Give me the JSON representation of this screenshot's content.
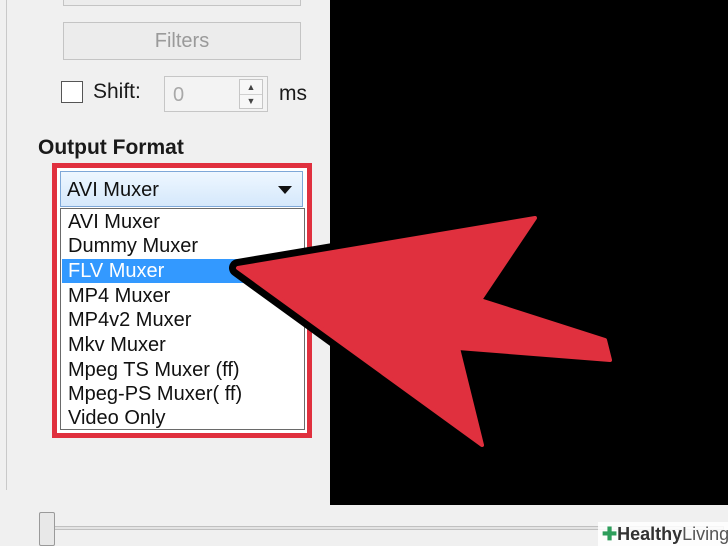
{
  "filters_label": "Filters",
  "shift": {
    "label": "Shift:",
    "checked": false,
    "value": "0",
    "unit": "ms"
  },
  "output_format": {
    "title": "Output Format",
    "selected": "AVI Muxer",
    "options": [
      "AVI Muxer",
      "Dummy Muxer",
      "FLV Muxer",
      "MP4 Muxer",
      "MP4v2 Muxer",
      "Mkv Muxer",
      "Mpeg TS Muxer (ff)",
      "Mpeg-PS Muxer( ff)",
      "Video Only"
    ],
    "highlighted": "FLV Muxer"
  },
  "watermark": {
    "bold": "Healthy",
    "light": "Living"
  },
  "colors": {
    "highlight": "#e0303e",
    "selection": "#3399ff",
    "video_bg": "#000000"
  },
  "icons": {
    "combo_arrow": "chevron-down-icon",
    "spin_up": "arrow-up-icon",
    "spin_down": "arrow-down-icon",
    "pointer": "red-arrow-annotation"
  }
}
